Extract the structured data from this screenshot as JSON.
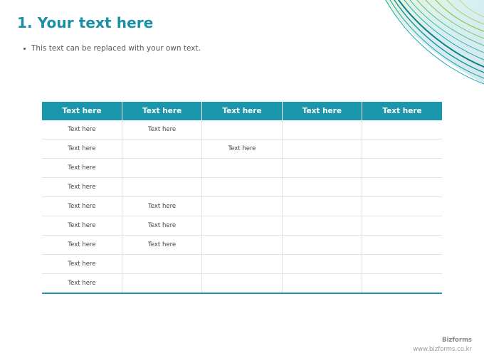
{
  "slide": {
    "title": "1. Your text here",
    "bullet": "This text can be replaced with your own text."
  },
  "table": {
    "headers": [
      "Text here",
      "Text here",
      "Text here",
      "Text here",
      "Text here"
    ],
    "rows": [
      [
        "Text here",
        "Text here",
        "",
        "",
        ""
      ],
      [
        "Text here",
        "",
        "Text here",
        "",
        ""
      ],
      [
        "Text here",
        "",
        "",
        "",
        ""
      ],
      [
        "Text here",
        "",
        "",
        "",
        ""
      ],
      [
        "Text here",
        "Text here",
        "",
        "",
        ""
      ],
      [
        "Text here",
        "Text here",
        "",
        "",
        ""
      ],
      [
        "Text here",
        "Text here",
        "",
        "",
        ""
      ],
      [
        "Text here",
        "",
        "",
        "",
        ""
      ],
      [
        "Text here",
        "",
        "",
        "",
        ""
      ]
    ]
  },
  "footer": {
    "brand": "Bizforms",
    "url": "www.bizforms.co.kr"
  },
  "colors": {
    "accent": "#1a8fa5",
    "header_bg": "#1a97ad",
    "swoosh_green": "#8cc63f",
    "swoosh_teal": "#1aa6b7"
  }
}
